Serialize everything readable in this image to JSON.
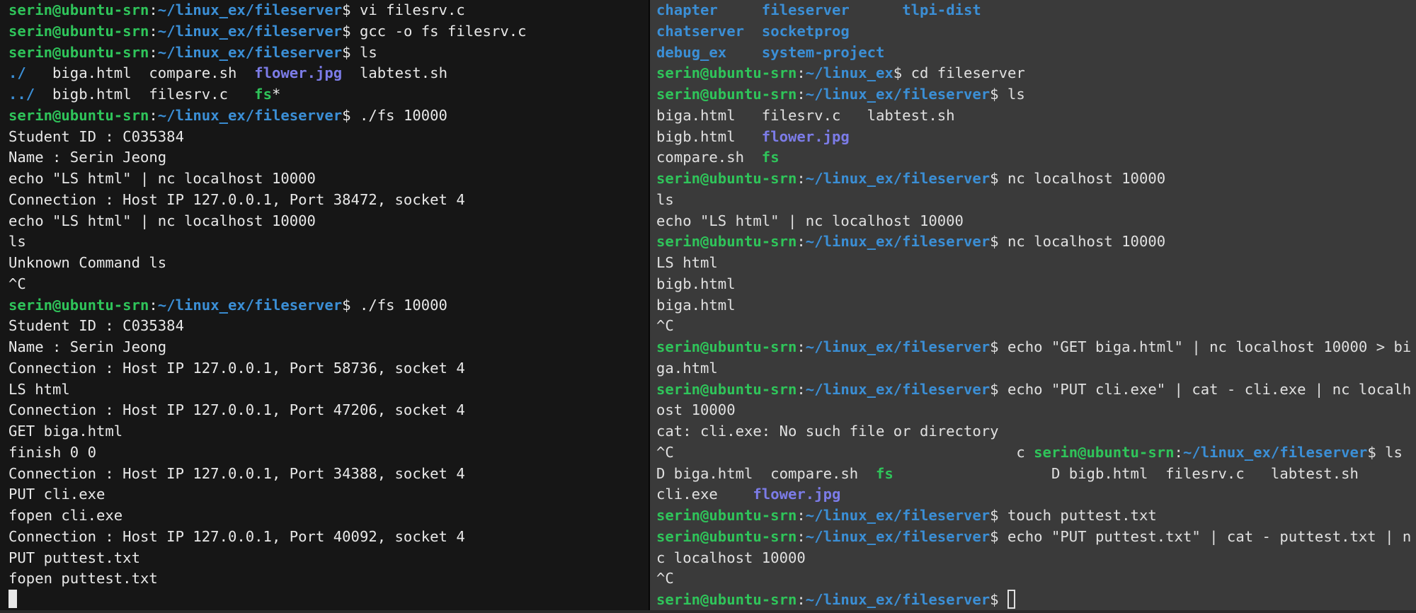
{
  "colors": {
    "user_host": "#2fc45a",
    "path": "#3b8fd6",
    "dir": "#3b8fd6",
    "image": "#7c7ce8",
    "exec": "#2fc45a",
    "text_left": "#e8e8e8",
    "text_right": "#e0e0e0",
    "bg_left": "#161616",
    "bg_right": "#3a3a3a"
  },
  "left_terminal": {
    "lines": [
      [
        {
          "t": "serin@ubuntu-srn",
          "c": "user_host",
          "b": true
        },
        {
          "t": ":",
          "c": "text"
        },
        {
          "t": "~/linux_ex/fileserver",
          "c": "path",
          "b": true
        },
        {
          "t": "$ vi filesrv.c",
          "c": "text"
        }
      ],
      [
        {
          "t": "serin@ubuntu-srn",
          "c": "user_host",
          "b": true
        },
        {
          "t": ":",
          "c": "text"
        },
        {
          "t": "~/linux_ex/fileserver",
          "c": "path",
          "b": true
        },
        {
          "t": "$ gcc -o fs filesrv.c",
          "c": "text"
        }
      ],
      [
        {
          "t": "serin@ubuntu-srn",
          "c": "user_host",
          "b": true
        },
        {
          "t": ":",
          "c": "text"
        },
        {
          "t": "~/linux_ex/fileserver",
          "c": "path",
          "b": true
        },
        {
          "t": "$ ls",
          "c": "text"
        }
      ],
      [
        {
          "t": "./",
          "c": "dir",
          "b": true
        },
        {
          "t": "   biga.html  compare.sh  ",
          "c": "text"
        },
        {
          "t": "flower.jpg",
          "c": "image",
          "b": true
        },
        {
          "t": "  labtest.sh",
          "c": "text"
        }
      ],
      [
        {
          "t": "../",
          "c": "dir",
          "b": true
        },
        {
          "t": "  bigb.html  filesrv.c   ",
          "c": "text"
        },
        {
          "t": "fs",
          "c": "exec",
          "b": true
        },
        {
          "t": "*",
          "c": "text"
        }
      ],
      [
        {
          "t": "serin@ubuntu-srn",
          "c": "user_host",
          "b": true
        },
        {
          "t": ":",
          "c": "text"
        },
        {
          "t": "~/linux_ex/fileserver",
          "c": "path",
          "b": true
        },
        {
          "t": "$ ./fs 10000",
          "c": "text"
        }
      ],
      [
        {
          "t": "Student ID : C035384",
          "c": "text"
        }
      ],
      [
        {
          "t": "Name : Serin Jeong",
          "c": "text"
        }
      ],
      [
        {
          "t": "echo \"LS html\" | nc localhost 10000",
          "c": "text"
        }
      ],
      [
        {
          "t": "Connection : Host IP 127.0.0.1, Port 38472, socket 4",
          "c": "text"
        }
      ],
      [
        {
          "t": "echo \"LS html\" | nc localhost 10000",
          "c": "text"
        }
      ],
      [
        {
          "t": "ls",
          "c": "text"
        }
      ],
      [
        {
          "t": "Unknown Command ls",
          "c": "text"
        }
      ],
      [
        {
          "t": "^C",
          "c": "text"
        }
      ],
      [
        {
          "t": "serin@ubuntu-srn",
          "c": "user_host",
          "b": true
        },
        {
          "t": ":",
          "c": "text"
        },
        {
          "t": "~/linux_ex/fileserver",
          "c": "path",
          "b": true
        },
        {
          "t": "$ ./fs 10000",
          "c": "text"
        }
      ],
      [
        {
          "t": "Student ID : C035384",
          "c": "text"
        }
      ],
      [
        {
          "t": "Name : Serin Jeong",
          "c": "text"
        }
      ],
      [
        {
          "t": "Connection : Host IP 127.0.0.1, Port 58736, socket 4",
          "c": "text"
        }
      ],
      [
        {
          "t": "LS html",
          "c": "text"
        }
      ],
      [
        {
          "t": "Connection : Host IP 127.0.0.1, Port 47206, socket 4",
          "c": "text"
        }
      ],
      [
        {
          "t": "GET biga.html",
          "c": "text"
        }
      ],
      [
        {
          "t": "finish 0 0",
          "c": "text"
        }
      ],
      [
        {
          "t": "Connection : Host IP 127.0.0.1, Port 34388, socket 4",
          "c": "text"
        }
      ],
      [
        {
          "t": "PUT cli.exe",
          "c": "text"
        }
      ],
      [
        {
          "t": "fopen cli.exe",
          "c": "text"
        }
      ],
      [
        {
          "t": "Connection : Host IP 127.0.0.1, Port 40092, socket 4",
          "c": "text"
        }
      ],
      [
        {
          "t": "PUT puttest.txt",
          "c": "text"
        }
      ],
      [
        {
          "t": "fopen puttest.txt",
          "c": "text"
        }
      ],
      [
        {
          "cursor": "block"
        }
      ]
    ]
  },
  "right_terminal": {
    "lines": [
      [
        {
          "t": "chapter",
          "c": "dir",
          "b": true
        },
        {
          "t": "     ",
          "c": "text"
        },
        {
          "t": "fileserver",
          "c": "dir",
          "b": true
        },
        {
          "t": "      ",
          "c": "text"
        },
        {
          "t": "tlpi-dist",
          "c": "dir",
          "b": true
        }
      ],
      [
        {
          "t": "chatserver",
          "c": "dir",
          "b": true
        },
        {
          "t": "  ",
          "c": "text"
        },
        {
          "t": "socketprog",
          "c": "dir",
          "b": true
        }
      ],
      [
        {
          "t": "debug_ex",
          "c": "dir",
          "b": true
        },
        {
          "t": "    ",
          "c": "text"
        },
        {
          "t": "system-project",
          "c": "dir",
          "b": true
        }
      ],
      [
        {
          "t": "serin@ubuntu-srn",
          "c": "user_host",
          "b": true
        },
        {
          "t": ":",
          "c": "text"
        },
        {
          "t": "~/linux_ex",
          "c": "path",
          "b": true
        },
        {
          "t": "$ cd fileserver",
          "c": "text"
        }
      ],
      [
        {
          "t": "serin@ubuntu-srn",
          "c": "user_host",
          "b": true
        },
        {
          "t": ":",
          "c": "text"
        },
        {
          "t": "~/linux_ex/fileserver",
          "c": "path",
          "b": true
        },
        {
          "t": "$ ls",
          "c": "text"
        }
      ],
      [
        {
          "t": "biga.html   filesrv.c   labtest.sh",
          "c": "text"
        }
      ],
      [
        {
          "t": "bigb.html   ",
          "c": "text"
        },
        {
          "t": "flower.jpg",
          "c": "image",
          "b": true
        }
      ],
      [
        {
          "t": "compare.sh  ",
          "c": "text"
        },
        {
          "t": "fs",
          "c": "exec",
          "b": true
        }
      ],
      [
        {
          "t": "serin@ubuntu-srn",
          "c": "user_host",
          "b": true
        },
        {
          "t": ":",
          "c": "text"
        },
        {
          "t": "~/linux_ex/fileserver",
          "c": "path",
          "b": true
        },
        {
          "t": "$ nc localhost 10000",
          "c": "text"
        }
      ],
      [
        {
          "t": "ls",
          "c": "text"
        }
      ],
      [
        {
          "t": "echo \"LS html\" | nc localhost 10000",
          "c": "text"
        }
      ],
      [
        {
          "t": "serin@ubuntu-srn",
          "c": "user_host",
          "b": true
        },
        {
          "t": ":",
          "c": "text"
        },
        {
          "t": "~/linux_ex/fileserver",
          "c": "path",
          "b": true
        },
        {
          "t": "$ nc localhost 10000",
          "c": "text"
        }
      ],
      [
        {
          "t": "LS html",
          "c": "text"
        }
      ],
      [
        {
          "t": "bigb.html",
          "c": "text"
        }
      ],
      [
        {
          "t": "biga.html",
          "c": "text"
        }
      ],
      [
        {
          "t": "^C",
          "c": "text"
        }
      ],
      [
        {
          "t": "serin@ubuntu-srn",
          "c": "user_host",
          "b": true
        },
        {
          "t": ":",
          "c": "text"
        },
        {
          "t": "~/linux_ex/fileserver",
          "c": "path",
          "b": true
        },
        {
          "t": "$ echo \"GET biga.html\" | nc localhost 10000 > bi",
          "c": "text"
        }
      ],
      [
        {
          "t": "ga.html",
          "c": "text"
        }
      ],
      [
        {
          "t": "serin@ubuntu-srn",
          "c": "user_host",
          "b": true
        },
        {
          "t": ":",
          "c": "text"
        },
        {
          "t": "~/linux_ex/fileserver",
          "c": "path",
          "b": true
        },
        {
          "t": "$ echo \"PUT cli.exe\" | cat - cli.exe | nc localh",
          "c": "text"
        }
      ],
      [
        {
          "t": "ost 10000",
          "c": "text"
        }
      ],
      [
        {
          "t": "cat: cli.exe: No such file or directory",
          "c": "text"
        }
      ],
      [
        {
          "t": "^C                                       c ",
          "c": "text"
        },
        {
          "t": "serin@ubuntu-srn",
          "c": "user_host",
          "b": true
        },
        {
          "t": ":",
          "c": "text"
        },
        {
          "t": "~/linux_ex/fileserver",
          "c": "path",
          "b": true
        },
        {
          "t": "$ ls",
          "c": "text"
        }
      ],
      [
        {
          "t": "D biga.html  compare.sh  ",
          "c": "text"
        },
        {
          "t": "fs",
          "c": "exec",
          "b": true
        },
        {
          "t": "                  D bigb.html  filesrv.c   labtest.sh",
          "c": "text"
        }
      ],
      [
        {
          "t": "cli.exe    ",
          "c": "text"
        },
        {
          "t": "flower.jpg",
          "c": "image",
          "b": true
        }
      ],
      [
        {
          "t": "serin@ubuntu-srn",
          "c": "user_host",
          "b": true
        },
        {
          "t": ":",
          "c": "text"
        },
        {
          "t": "~/linux_ex/fileserver",
          "c": "path",
          "b": true
        },
        {
          "t": "$ touch puttest.txt",
          "c": "text"
        }
      ],
      [
        {
          "t": "serin@ubuntu-srn",
          "c": "user_host",
          "b": true
        },
        {
          "t": ":",
          "c": "text"
        },
        {
          "t": "~/linux_ex/fileserver",
          "c": "path",
          "b": true
        },
        {
          "t": "$ echo \"PUT puttest.txt\" | cat - puttest.txt | n",
          "c": "text"
        }
      ],
      [
        {
          "t": "c localhost 10000",
          "c": "text"
        }
      ],
      [
        {
          "t": "^C",
          "c": "text"
        }
      ],
      [
        {
          "t": "serin@ubuntu-srn",
          "c": "user_host",
          "b": true
        },
        {
          "t": ":",
          "c": "text"
        },
        {
          "t": "~/linux_ex/fileserver",
          "c": "path",
          "b": true
        },
        {
          "t": "$ ",
          "c": "text"
        },
        {
          "cursor": "outline"
        }
      ]
    ]
  }
}
